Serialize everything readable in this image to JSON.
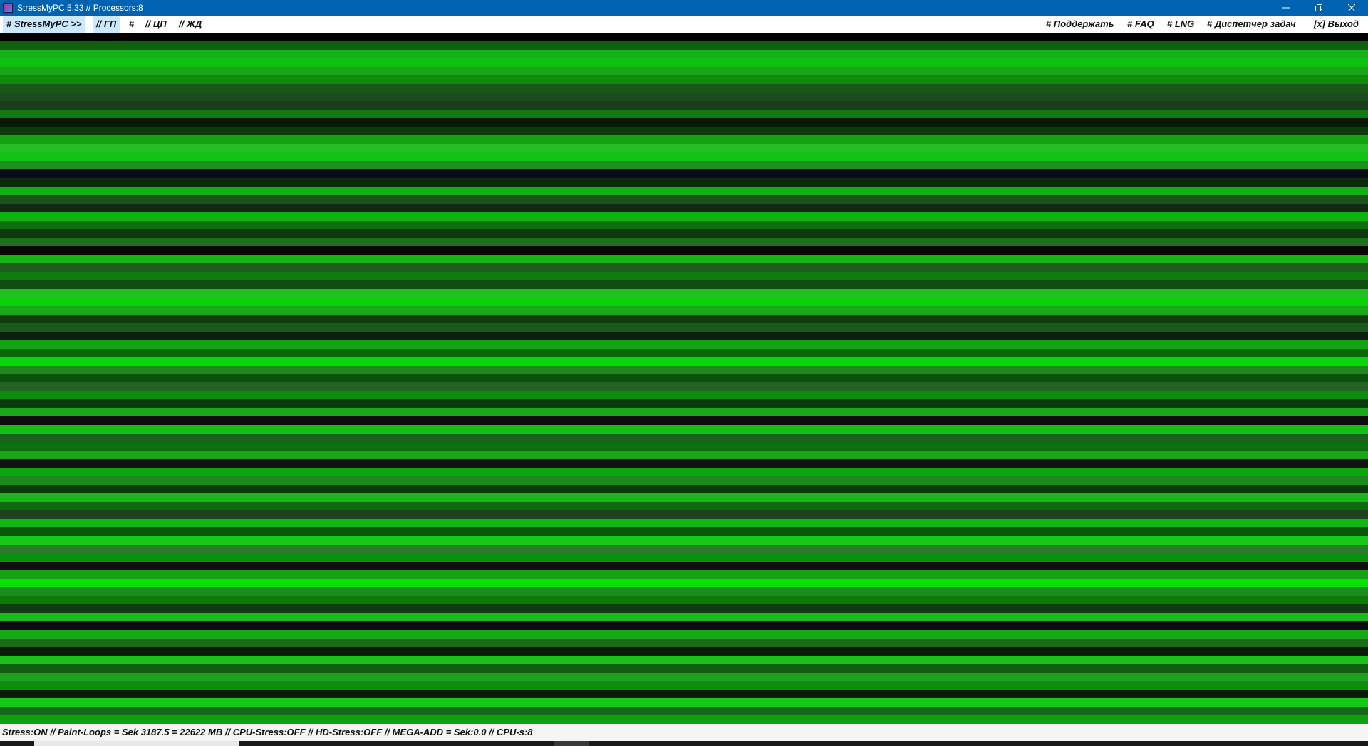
{
  "window": {
    "title": "StressMyPC 5.33 // Processors:8",
    "icon": "app-icon",
    "controls": [
      "minimize-icon",
      "restore-icon",
      "close-icon"
    ]
  },
  "menu": {
    "left": [
      {
        "label": "# StressMyPC >>",
        "active": true
      },
      {
        "label": "// ГП",
        "active": true
      },
      {
        "label": "#",
        "active": false
      },
      {
        "label": "// ЦП",
        "active": false
      },
      {
        "label": "// ЖД",
        "active": false
      }
    ],
    "right": [
      {
        "label": "# Поддержать"
      },
      {
        "label": "# FAQ"
      },
      {
        "label": "# LNG"
      },
      {
        "label": "# Диспетчер задач"
      },
      {
        "label": "[x] Выход"
      }
    ]
  },
  "status": {
    "text": "Stress:ON // Paint-Loops = Sek 3187.5 = 22622 MB // CPU-Stress:OFF // HD-Stress:OFF // MEGA-ADD = Sek:0.0 // CPU-s:8"
  },
  "colors": {
    "titlebar": "#0063b1",
    "menu_active": "#cce8ff",
    "status_bg": "#f5f5f5",
    "stripes": [
      "#000000",
      "#0f6010",
      "#18b018",
      "#10c010",
      "#19a419",
      "#0f8a0f",
      "#175717",
      "#1e4a1e",
      "#1c3d1c",
      "#137a13",
      "#0a1a0a",
      "#0e3a0e",
      "#13a013",
      "#23be23",
      "#13c313",
      "#1e8e1e",
      "#0c0c14",
      "#0c2a0c",
      "#13ae13",
      "#1b541b",
      "#142814",
      "#0fb20f",
      "#107010",
      "#0b3a0b",
      "#1f6f1f",
      "#080808",
      "#14b414",
      "#1d5c1d",
      "#117b11",
      "#0d4d0d",
      "#20c020",
      "#0ad00a",
      "#17a717",
      "#0e3c0e",
      "#1a591a",
      "#0f1f0f",
      "#12a312",
      "#0a660a",
      "#0bd80b",
      "#1d891d",
      "#0e500e",
      "#226222",
      "#0c8c0c",
      "#093a09",
      "#16a816",
      "#0c0c0c",
      "#13c013",
      "#1c621c",
      "#0f6f0f",
      "#1aa51a",
      "#121212",
      "#0fa50f",
      "#1a8a1a",
      "#0a3a0a",
      "#1bb61b",
      "#0e6a0e",
      "#1f411f",
      "#12b612",
      "#0a550a",
      "#16c716",
      "#2a7a2a",
      "#0d8d0d",
      "#101010",
      "#14a214",
      "#08e008",
      "#1c8c1c",
      "#0a7a0a",
      "#103a10",
      "#18bb18",
      "#0c0c0c",
      "#15aa15",
      "#1a6a1a",
      "#0b1b0b",
      "#19c019",
      "#0e5e0e",
      "#20a020",
      "#0d8d0d",
      "#0a1a0a",
      "#14c814",
      "#17671b",
      "#0fa00f"
    ]
  }
}
